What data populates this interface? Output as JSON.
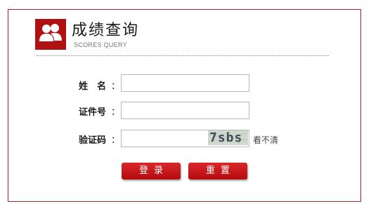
{
  "header": {
    "title": "成绩查询",
    "subtitle": "SCORES QUERY",
    "icon": "users-icon"
  },
  "form": {
    "name_label": "姓　名",
    "id_label": "证件号",
    "captcha_label": "验证码",
    "colon": "：",
    "name_value": "",
    "id_value": "",
    "captcha_value": "",
    "captcha_image_text": "7sbs",
    "refresh_label": "看不清"
  },
  "buttons": {
    "login": "登录",
    "reset": "重置"
  },
  "colors": {
    "accent": "#b01212",
    "border": "#a0282a",
    "button_top": "#d9282a",
    "button_bottom": "#b40b0e"
  }
}
